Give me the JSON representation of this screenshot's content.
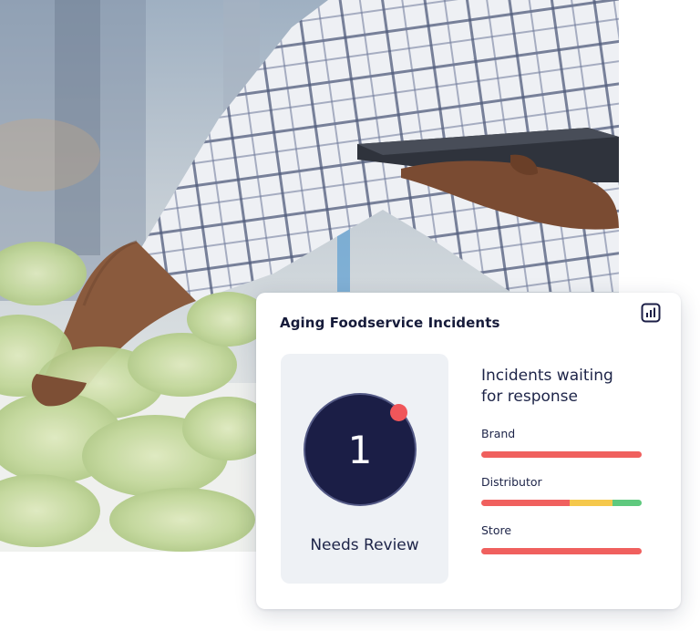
{
  "card": {
    "title": "Aging Foodservice Incidents",
    "status": {
      "count": "1",
      "label": "Needs Review",
      "circle_color": "#1b1e46",
      "alert_color": "#f0565a"
    },
    "summary_heading_line1": "Incidents waiting",
    "summary_heading_line2": "for response",
    "categories": [
      {
        "label": "Brand",
        "segments": [
          {
            "color": "#f0605e",
            "fraction": 1.0
          }
        ]
      },
      {
        "label": "Distributor",
        "segments": [
          {
            "color": "#f0605e",
            "fraction": 0.55
          },
          {
            "color": "#f5c84c",
            "fraction": 0.27
          },
          {
            "color": "#5fc97e",
            "fraction": 0.18
          }
        ]
      },
      {
        "label": "Store",
        "segments": [
          {
            "color": "#f0605e",
            "fraction": 1.0
          }
        ]
      }
    ],
    "icons": {
      "chart": "bar-chart-icon"
    }
  },
  "background": {
    "description_icon": "greenhouse-photo"
  }
}
